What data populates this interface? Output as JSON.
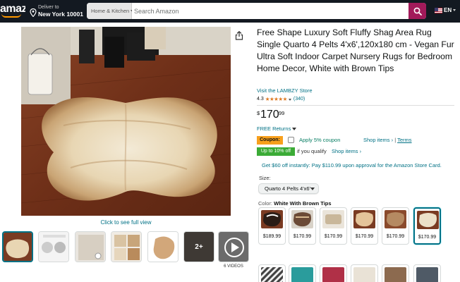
{
  "header": {
    "logo_text": "amazon",
    "deliver_line1": "Deliver to",
    "deliver_line2": "New York 10001",
    "search_category": "Home & Kitchen",
    "search_placeholder": "Search Amazon",
    "language": "EN"
  },
  "gallery": {
    "see_full_view": "Click to see full view",
    "more_count": "2+",
    "videos_label": "6 VIDEOS"
  },
  "product": {
    "title": "Free Shape Luxury Soft Fluffy Shag Area Rug Single Quarto 4 Pelts 4'x6',120x180 cm - Vegan Fur Ultra Soft Indoor Carpet Nursery Rugs for Bedroom Home Decor, White with Brown Tips",
    "store_link": "Visit the LAMBZY Store",
    "rating_value": "4.3",
    "rating_stars": 4.3,
    "rating_count": "(340)",
    "price_symbol": "$",
    "price_whole": "170",
    "price_fraction": "99",
    "returns": "FREE Returns",
    "coupon_tag": "Coupon:",
    "coupon_apply": "Apply 5% coupon",
    "coupon_shop": "Shop items ›",
    "coupon_sep": "|",
    "coupon_terms": "Terms",
    "deal_tag": "Up to 10% off",
    "deal_text": "if you qualify",
    "deal_shop": "Shop items ›",
    "card_offer": "Get $60 off instantly: Pay $110.99 upon approval for the Amazon Store Card.",
    "size_label": "Size:",
    "size_selected": "Quarto 4 Pelts 4'x6'",
    "color_label": "Color:",
    "color_selected": "White With Brown Tips"
  },
  "swatches": [
    {
      "price": "$189.99",
      "selected": false
    },
    {
      "price": "$170.99",
      "selected": false
    },
    {
      "price": "$170.99",
      "selected": false
    },
    {
      "price": "$170.99",
      "selected": false
    },
    {
      "price": "$170.99",
      "selected": false
    },
    {
      "price": "$170.99",
      "selected": true
    }
  ],
  "colors": {
    "header_bg": "#131921",
    "search_button": "#a21a5a",
    "link": "#007185",
    "coupon": "#f7a01d",
    "deal": "#3bab36",
    "star": "#de7921"
  }
}
